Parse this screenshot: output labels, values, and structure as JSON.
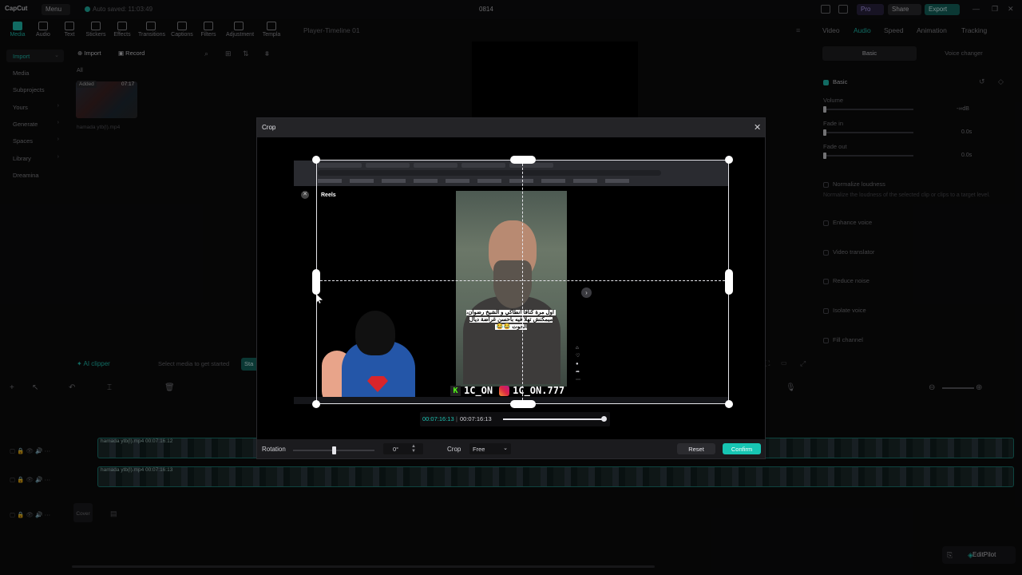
{
  "app": {
    "logo": "CapCut",
    "menu_label": "Menu",
    "autosave": "Auto saved: 11:03:49",
    "project_title": "0814",
    "pro_label": "Pro",
    "share_label": "Share",
    "export_label": "Export"
  },
  "toolbar": {
    "items": [
      {
        "label": "Media",
        "icon": "media-icon",
        "active": true
      },
      {
        "label": "Audio",
        "icon": "audio-icon"
      },
      {
        "label": "Text",
        "icon": "text-icon"
      },
      {
        "label": "Stickers",
        "icon": "stickers-icon"
      },
      {
        "label": "Effects",
        "icon": "effects-icon"
      },
      {
        "label": "Transitions",
        "icon": "transitions-icon"
      },
      {
        "label": "Captions",
        "icon": "captions-icon"
      },
      {
        "label": "Filters",
        "icon": "filters-icon"
      },
      {
        "label": "Adjustment",
        "icon": "adjustment-icon"
      },
      {
        "label": "Templa",
        "icon": "templates-icon"
      }
    ]
  },
  "leftnav": {
    "items": [
      {
        "label": "Import",
        "selected": true
      },
      {
        "label": "Media"
      },
      {
        "label": "Subprojects"
      },
      {
        "label": "Yours"
      },
      {
        "label": "Generate"
      },
      {
        "label": "Spaces"
      },
      {
        "label": "Library"
      },
      {
        "label": "Dreamina"
      }
    ]
  },
  "media": {
    "import_label": "Import",
    "record_label": "Record",
    "filter_all": "All",
    "thumb_added": "Added",
    "thumb_duration": "07:17",
    "thumb_name": "hamada ytb(l).mp4"
  },
  "aiclipper": {
    "label": "AI clipper",
    "hint": "Select media to get started",
    "start_label": "Sta"
  },
  "player": {
    "title": "Player-Timeline 01"
  },
  "rightpanel": {
    "tabs": [
      "Video",
      "Audio",
      "Speed",
      "Animation",
      "Tracking"
    ],
    "selected_tab": "Audio",
    "segments": [
      "Basic",
      "Voice changer"
    ],
    "basic_label": "Basic",
    "volume_label": "Volume",
    "volume_value": "-∞dB",
    "fadein_label": "Fade in",
    "fadein_value": "0.0s",
    "fadeout_label": "Fade out",
    "fadeout_value": "0.0s",
    "normalize_label": "Normalize loudness",
    "normalize_hint": "Normalize the loudness of the selected clip or clips to a target level.",
    "enhance_label": "Enhance voice",
    "translator_label": "Video translator",
    "reduce_label": "Reduce noise",
    "isolate_label": "Isolate voice",
    "fill_label": "Fill channel"
  },
  "timeline": {
    "track1_label": "hamada ytb(l).mp4  00:07:16:12",
    "track2_label": "hamada ytb(l).mp4  00:07:16:13",
    "cover_label": "Cover"
  },
  "crop": {
    "title": "Crop",
    "timecode_current": "00:07:16:13",
    "timecode_separator": "|",
    "timecode_total": "00:07:16:13",
    "rotation_label": "Rotation",
    "rotation_value": "0°",
    "crop_label": "Crop",
    "crop_ratio": "Free",
    "reset_label": "Reset",
    "confirm_label": "Confirm",
    "reels_label": "Reels",
    "caption": "اول مرة كنافا انطاكي و الشيخ رضوان، ميمكنش تهلا فيه باحسن غراضة ديال الحوت 😂😂",
    "social_kick": "1C_ON",
    "social_ig": "1C_ON.777"
  },
  "editpilot": {
    "label": "EditPilot"
  },
  "colors": {
    "accent": "#1fc2b2",
    "confirm": "#17c5b3",
    "dialog_bg": "#242427"
  }
}
